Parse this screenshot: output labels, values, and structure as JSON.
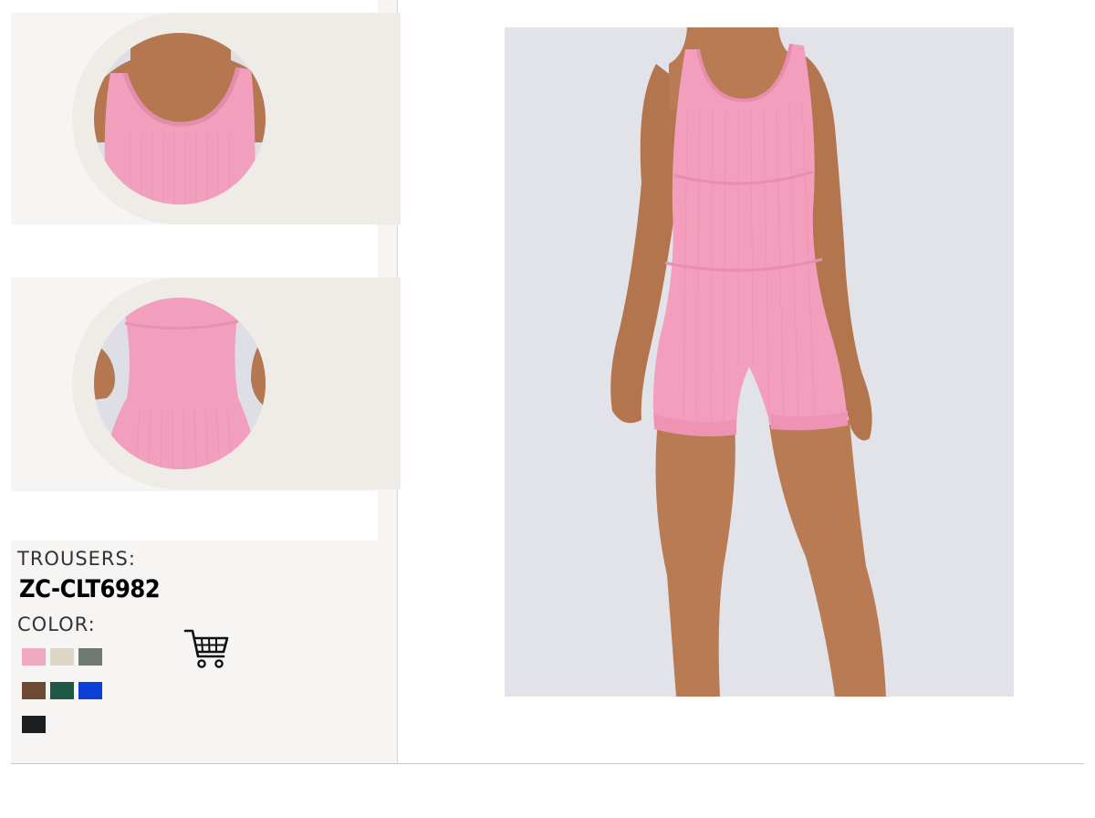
{
  "product": {
    "category_label": "TROUSERS:",
    "code": "ZC-CLT6982",
    "color_label": "COLOR:"
  },
  "colors": {
    "swatches": [
      "#f0a9c3",
      "#dcd6c8",
      "#6f7a73",
      "#6e4a34",
      "#1f5746",
      "#0b3fd6",
      "#1c1e20"
    ],
    "skin": "#b67a52",
    "fabric": "#f39fbd",
    "background": "#e1e1e8"
  },
  "icons": {
    "cart": "shopping-cart-icon"
  }
}
